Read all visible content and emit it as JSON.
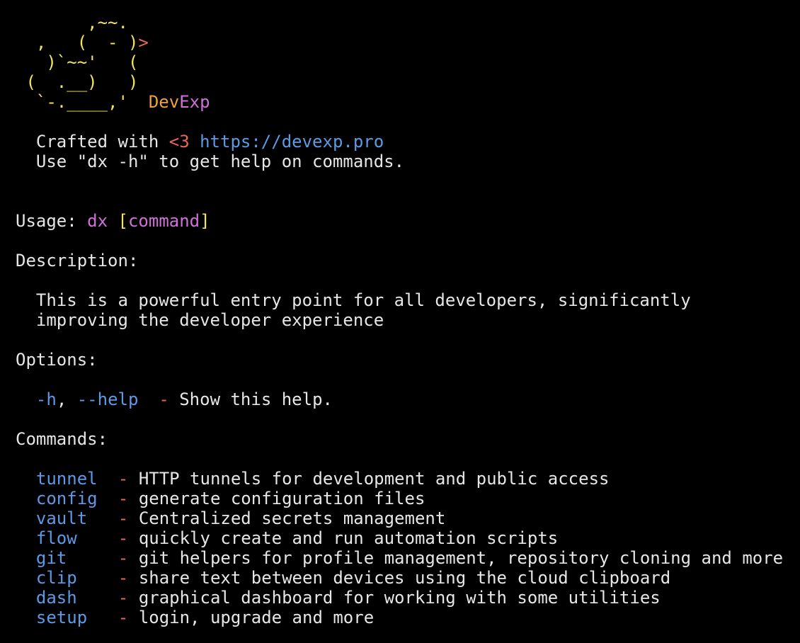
{
  "banner": {
    "ascii": [
      "       ,~~.",
      "  ,   (  - )",
      "   )`~~'   (",
      " (  .__)   )",
      "  `-.____,'  "
    ],
    "beak": ">",
    "brand_dev": "Dev",
    "brand_exp": "Exp",
    "credit_prefix": "Crafted with ",
    "credit_heart": "<3",
    "credit_url": "https://devexp.pro",
    "help_hint": "Use \"dx -h\" to get help on commands."
  },
  "usage": {
    "label": "Usage:",
    "bin": "dx",
    "open_bracket": "[",
    "arg": "command",
    "close_bracket": "]"
  },
  "description": {
    "label": "Description:",
    "lines": [
      "This is a powerful entry point for all developers, significantly",
      "improving the developer experience"
    ]
  },
  "options": {
    "label": "Options:",
    "items": [
      {
        "short": "-h",
        "sep": ", ",
        "long": "--help",
        "desc": "Show this help."
      }
    ]
  },
  "commands": {
    "label": "Commands:",
    "items": [
      {
        "name": "tunnel",
        "desc": "HTTP tunnels for development and public access"
      },
      {
        "name": "config",
        "desc": "generate configuration files"
      },
      {
        "name": "vault",
        "desc": "Centralized secrets management"
      },
      {
        "name": "flow",
        "desc": "quickly create and run automation scripts"
      },
      {
        "name": "git",
        "desc": "git helpers for profile management, repository cloning and more"
      },
      {
        "name": "clip",
        "desc": "share text between devices using the cloud clipboard"
      },
      {
        "name": "dash",
        "desc": "graphical dashboard for working with some utilities"
      },
      {
        "name": "setup",
        "desc": "login, upgrade and more"
      }
    ]
  },
  "dash_char": "-",
  "colors": {
    "background": "#000000",
    "text": "#e6e6e6",
    "ascii_yellow": "#f2e55c",
    "accent_red": "#e8685c",
    "brand_orange": "#f0a03c",
    "magenta": "#d070d8",
    "link_blue": "#5c9ae6"
  }
}
